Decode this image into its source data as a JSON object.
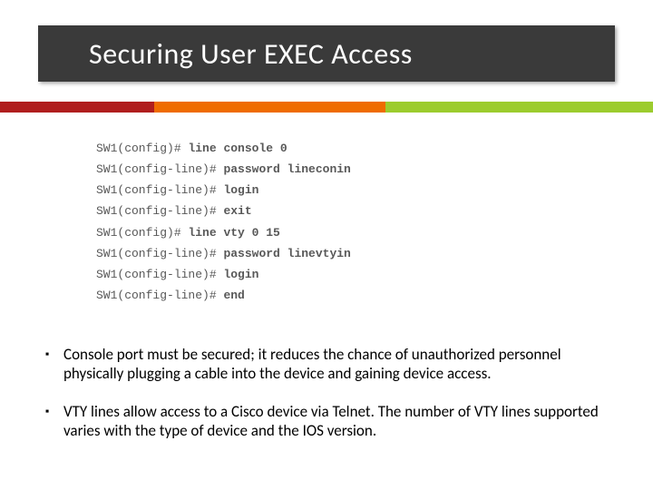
{
  "title": "Securing User EXEC Access",
  "stripe_colors": {
    "red": "#b01e1e",
    "orange": "#ef6c00",
    "green": "#9ccc2e"
  },
  "code_lines": [
    {
      "prompt": "SW1(config)#",
      "cmd": "line console 0"
    },
    {
      "prompt": "SW1(config-line)#",
      "cmd": "password lineconin"
    },
    {
      "prompt": "SW1(config-line)#",
      "cmd": "login"
    },
    {
      "prompt": "SW1(config-line)#",
      "cmd": "exit"
    },
    {
      "prompt": "SW1(config)#",
      "cmd": "line vty 0 15"
    },
    {
      "prompt": "SW1(config-line)#",
      "cmd": "password linevtyin"
    },
    {
      "prompt": "SW1(config-line)#",
      "cmd": "login"
    },
    {
      "prompt": "SW1(config-line)#",
      "cmd": "end"
    }
  ],
  "bullets": [
    "Console port must be secured; it reduces the chance of unauthorized personnel physically plugging a cable into the device and gaining device access.",
    "VTY lines allow access to a Cisco device via Telnet. The number of VTY lines supported varies with the type of device and the IOS version."
  ],
  "bullet_glyph": "▪"
}
